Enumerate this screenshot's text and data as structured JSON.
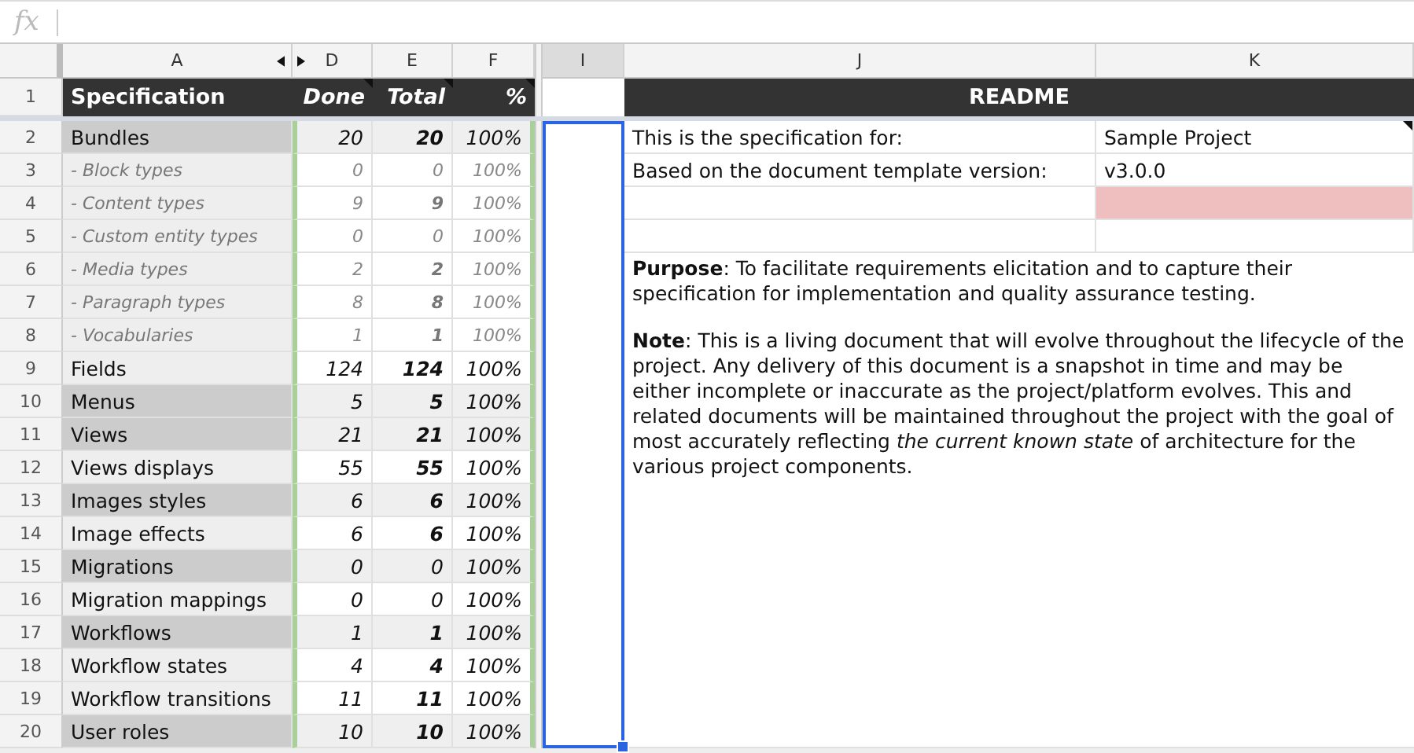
{
  "formula_bar": {
    "label": "fx"
  },
  "column_headers": [
    {
      "label": "A",
      "selected": false,
      "hidden_after": true
    },
    {
      "label": "D",
      "selected": false,
      "hidden_before": true
    },
    {
      "label": "E",
      "selected": false
    },
    {
      "label": "F",
      "selected": false
    },
    {
      "label": "I",
      "selected": true
    },
    {
      "label": "J",
      "selected": false
    },
    {
      "label": "K",
      "selected": false
    }
  ],
  "row_numbers": [
    "1",
    "2",
    "3",
    "4",
    "5",
    "6",
    "7",
    "8",
    "9",
    "10",
    "11",
    "12",
    "13",
    "14",
    "15",
    "16",
    "17",
    "18",
    "19",
    "20"
  ],
  "spec_header": {
    "title": "Specification",
    "columns": [
      {
        "label": "Done",
        "note": true
      },
      {
        "label": "Total",
        "note": true
      },
      {
        "label": "%",
        "note": true
      }
    ]
  },
  "readme_header": "README",
  "spec_rows": [
    {
      "kind": "main",
      "shaded": true,
      "name": "Bundles",
      "done": "20",
      "total": "20",
      "total_bold": true,
      "percent": "100%"
    },
    {
      "kind": "sub",
      "shaded": false,
      "name": "- Block types",
      "done": "0",
      "total": "0",
      "total_bold": false,
      "percent": "100%"
    },
    {
      "kind": "sub",
      "shaded": false,
      "name": "- Content types",
      "done": "9",
      "total": "9",
      "total_bold": true,
      "percent": "100%"
    },
    {
      "kind": "sub",
      "shaded": false,
      "name": "- Custom entity types",
      "done": "0",
      "total": "0",
      "total_bold": false,
      "percent": "100%"
    },
    {
      "kind": "sub",
      "shaded": false,
      "name": "- Media types",
      "done": "2",
      "total": "2",
      "total_bold": true,
      "percent": "100%"
    },
    {
      "kind": "sub",
      "shaded": false,
      "name": "- Paragraph types",
      "done": "8",
      "total": "8",
      "total_bold": true,
      "percent": "100%"
    },
    {
      "kind": "sub",
      "shaded": false,
      "name": "- Vocabularies",
      "done": "1",
      "total": "1",
      "total_bold": true,
      "percent": "100%"
    },
    {
      "kind": "main",
      "shaded": false,
      "name": "Fields",
      "done": "124",
      "total": "124",
      "total_bold": true,
      "percent": "100%"
    },
    {
      "kind": "main",
      "shaded": true,
      "name": "Menus",
      "done": "5",
      "total": "5",
      "total_bold": true,
      "percent": "100%"
    },
    {
      "kind": "main",
      "shaded": true,
      "name": "Views",
      "done": "21",
      "total": "21",
      "total_bold": true,
      "percent": "100%"
    },
    {
      "kind": "main",
      "shaded": false,
      "name": "Views displays",
      "done": "55",
      "total": "55",
      "total_bold": true,
      "percent": "100%"
    },
    {
      "kind": "main",
      "shaded": true,
      "name": "Images styles",
      "done": "6",
      "total": "6",
      "total_bold": true,
      "percent": "100%"
    },
    {
      "kind": "main",
      "shaded": false,
      "name": "Image effects",
      "done": "6",
      "total": "6",
      "total_bold": true,
      "percent": "100%"
    },
    {
      "kind": "main",
      "shaded": true,
      "name": "Migrations",
      "done": "0",
      "total": "0",
      "total_bold": false,
      "percent": "100%"
    },
    {
      "kind": "main",
      "shaded": false,
      "name": "Migration mappings",
      "done": "0",
      "total": "0",
      "total_bold": false,
      "percent": "100%"
    },
    {
      "kind": "main",
      "shaded": true,
      "name": "Workflows",
      "done": "1",
      "total": "1",
      "total_bold": true,
      "percent": "100%"
    },
    {
      "kind": "main",
      "shaded": false,
      "name": "Workflow states",
      "done": "4",
      "total": "4",
      "total_bold": true,
      "percent": "100%"
    },
    {
      "kind": "main",
      "shaded": false,
      "name": "Workflow transitions",
      "done": "11",
      "total": "11",
      "total_bold": true,
      "percent": "100%"
    },
    {
      "kind": "main",
      "shaded": true,
      "name": "User roles",
      "done": "10",
      "total": "10",
      "total_bold": true,
      "percent": "100%"
    }
  ],
  "readme_rows": [
    {
      "label": "This is the specification for:",
      "value": "Sample Project",
      "note": true,
      "flagged": false
    },
    {
      "label": "Based on the document template version:",
      "value": "v3.0.0",
      "note": false,
      "flagged": false
    },
    {
      "note": false,
      "flagged": true
    },
    {
      "note": false,
      "flagged": false
    }
  ],
  "paragraphs": [
    "**Purpose**: To facilitate requirements elicitation and to capture their specification for implementation and quality assurance testing.",
    "**Note**: This is a living document that will evolve throughout the lifecycle of the project. Any delivery of this document is a snapshot in time and may be either incomplete or inaccurate as the project/platform evolves. This and related documents will be maintained throughout the project with the goal of most accurately reflecting *the current known state* of architecture for the various project components."
  ]
}
